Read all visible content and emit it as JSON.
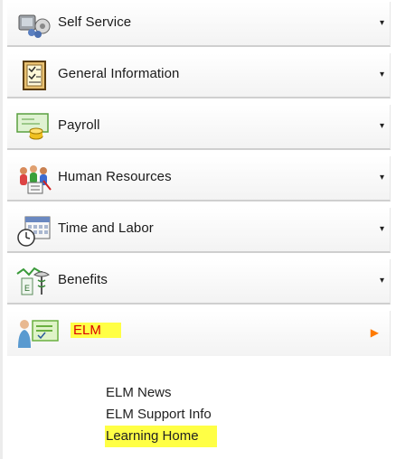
{
  "menu": {
    "items": [
      {
        "label": "Self Service",
        "icon": "self-service-icon"
      },
      {
        "label": "General Information",
        "icon": "general-information-icon"
      },
      {
        "label": "Payroll",
        "icon": "payroll-icon"
      },
      {
        "label": "Human Resources",
        "icon": "human-resources-icon"
      },
      {
        "label": "Time and Labor",
        "icon": "time-and-labor-icon"
      },
      {
        "label": "Benefits",
        "icon": "benefits-icon"
      },
      {
        "label": "ELM",
        "icon": "elm-icon",
        "expanded": true
      }
    ],
    "collapsed_arrow": "▾",
    "expanded_arrow": "▶",
    "elm_submenu": [
      {
        "label": "ELM News"
      },
      {
        "label": "ELM Support Info"
      },
      {
        "label": "Learning Home",
        "highlighted": true
      }
    ]
  },
  "colors": {
    "highlight": "#ffff45",
    "elm_text": "#d90000",
    "expanded_arrow": "#ff7a00"
  }
}
